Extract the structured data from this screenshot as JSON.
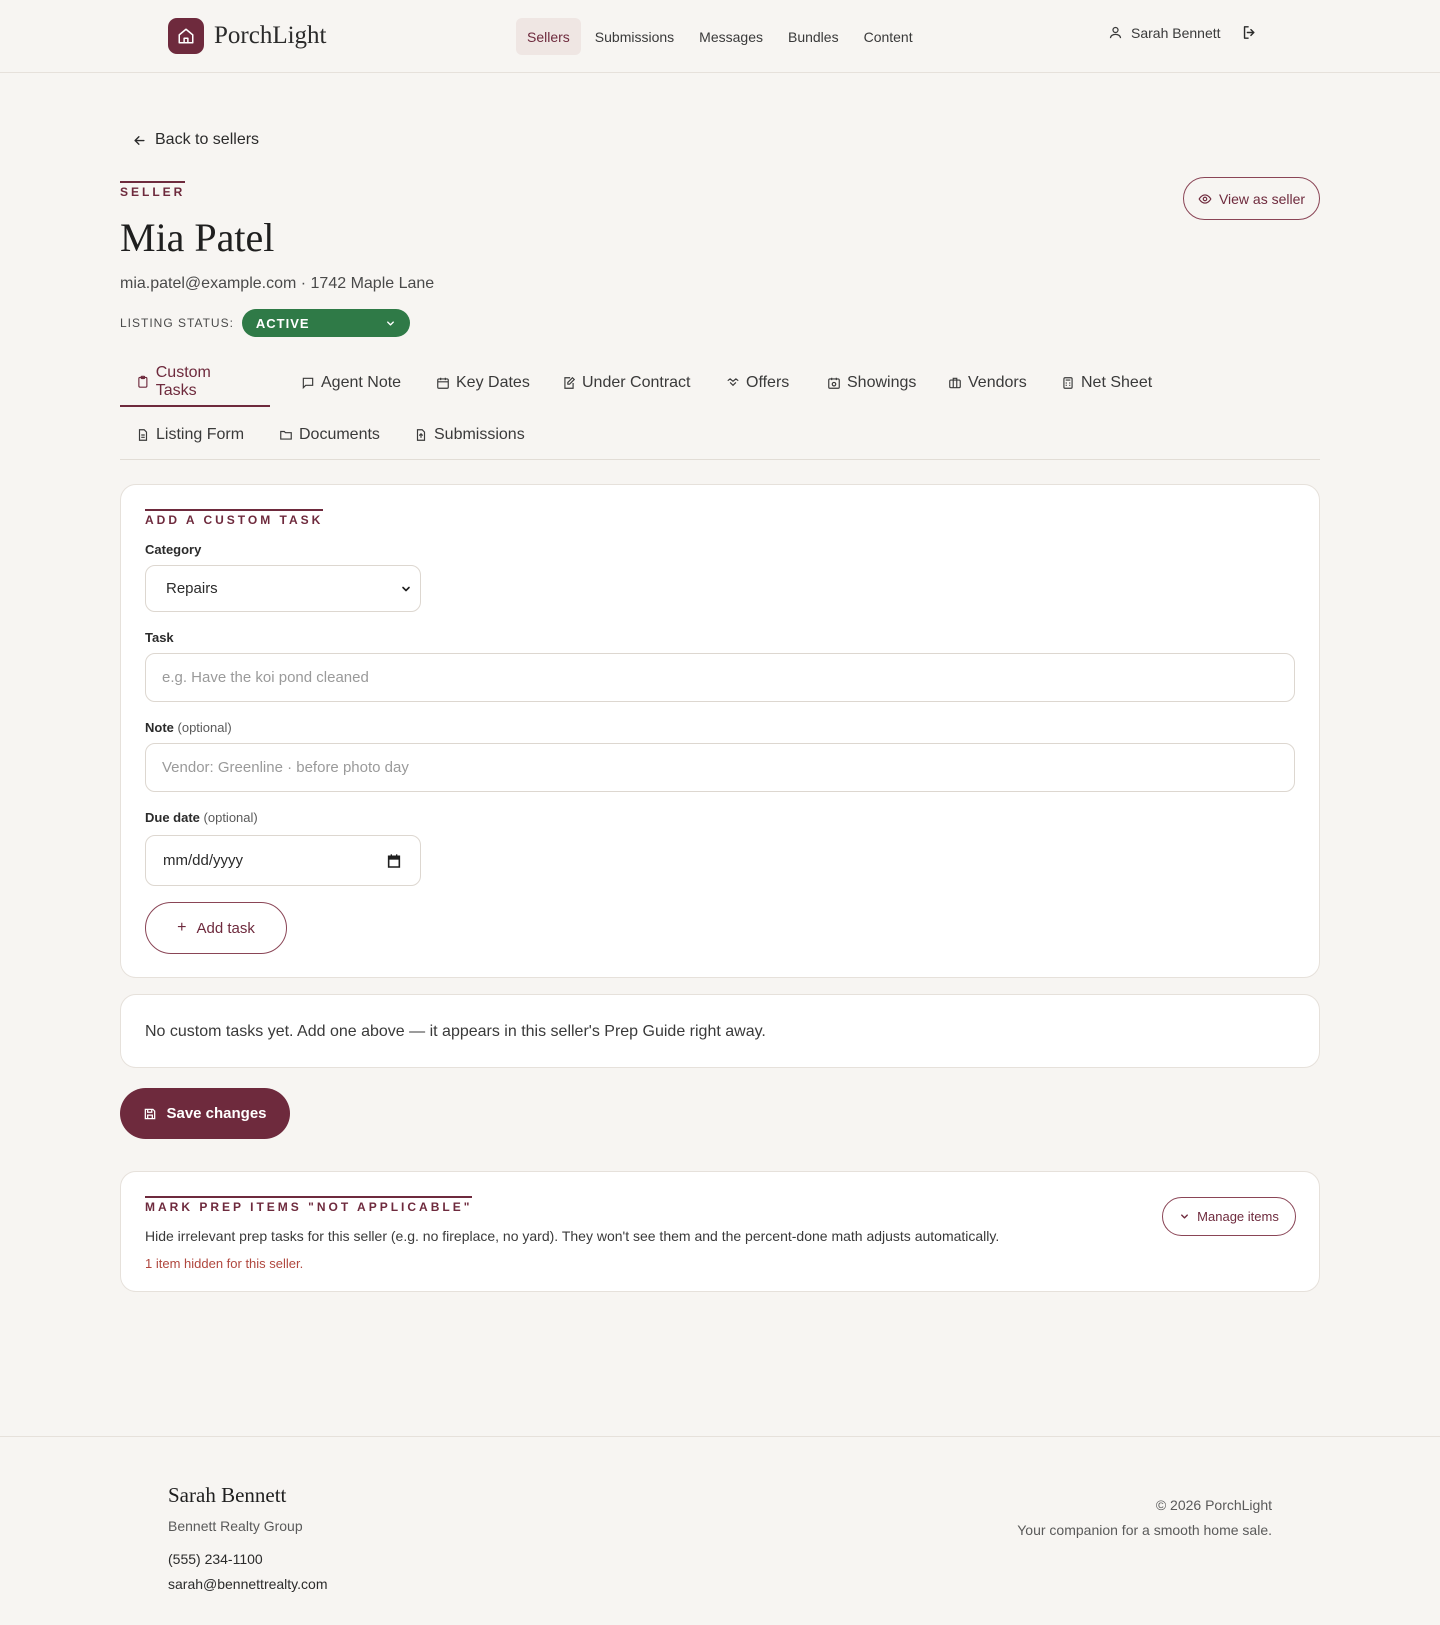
{
  "brand": {
    "name": "PorchLight",
    "accent": "#6e2a3d",
    "status_green": "#2f7a47"
  },
  "nav": [
    {
      "label": "Sellers",
      "active": true
    },
    {
      "label": "Submissions"
    },
    {
      "label": "Messages"
    },
    {
      "label": "Bundles"
    },
    {
      "label": "Content"
    }
  ],
  "user": {
    "name": "Sarah Bennett"
  },
  "back_label": "Back to sellers",
  "seller": {
    "eyebrow": "SELLER",
    "name": "Mia Patel",
    "meta": "mia.patel@example.com · 1742 Maple Lane",
    "status_label": "LISTING STATUS:",
    "status_value": "ACTIVE",
    "view_as_label": "View as seller"
  },
  "tabs": [
    {
      "label": "Custom Tasks",
      "icon": "clipboard-icon",
      "active": true
    },
    {
      "label": "Agent Note",
      "icon": "message-icon"
    },
    {
      "label": "Key Dates",
      "icon": "calendar-icon"
    },
    {
      "label": "Under Contract",
      "icon": "edit-icon"
    },
    {
      "label": "Offers",
      "icon": "handshake-icon"
    },
    {
      "label": "Showings",
      "icon": "calendar-clock-icon"
    },
    {
      "label": "Vendors",
      "icon": "briefcase-icon"
    },
    {
      "label": "Net Sheet",
      "icon": "calculator-icon"
    },
    {
      "label": "Listing Form",
      "icon": "document-icon"
    },
    {
      "label": "Documents",
      "icon": "folder-icon"
    },
    {
      "label": "Submissions",
      "icon": "file-upload-icon"
    }
  ],
  "add_task": {
    "eyebrow": "ADD A CUSTOM TASK",
    "category_label": "Category",
    "category_value": "Repairs",
    "task_label": "Task",
    "task_placeholder": "e.g. Have the koi pond cleaned",
    "note_label": "Note",
    "note_optional": "(optional)",
    "note_placeholder": "Vendor: Greenline · before photo day",
    "due_label": "Due date",
    "due_optional": "(optional)",
    "due_placeholder": "mm/dd/yyyy",
    "add_button": "Add task"
  },
  "empty_message": "No custom tasks yet. Add one above — it appears in this seller's Prep Guide right away.",
  "save_label": "Save changes",
  "prep": {
    "eyebrow": "MARK PREP ITEMS \"NOT APPLICABLE\"",
    "description": "Hide irrelevant prep tasks for this seller (e.g. no fireplace, no yard). They won't see them and the percent-done math adjusts automatically.",
    "hidden_count": "1 item hidden for this seller.",
    "manage_label": "Manage items"
  },
  "footer": {
    "agent_name": "Sarah Bennett",
    "org": "Bennett Realty Group",
    "phone": "(555) 234-1100",
    "email": "sarah@bennettrealty.com",
    "copyright": "© 2026 PorchLight",
    "tagline": "Your companion for a smooth home sale."
  }
}
